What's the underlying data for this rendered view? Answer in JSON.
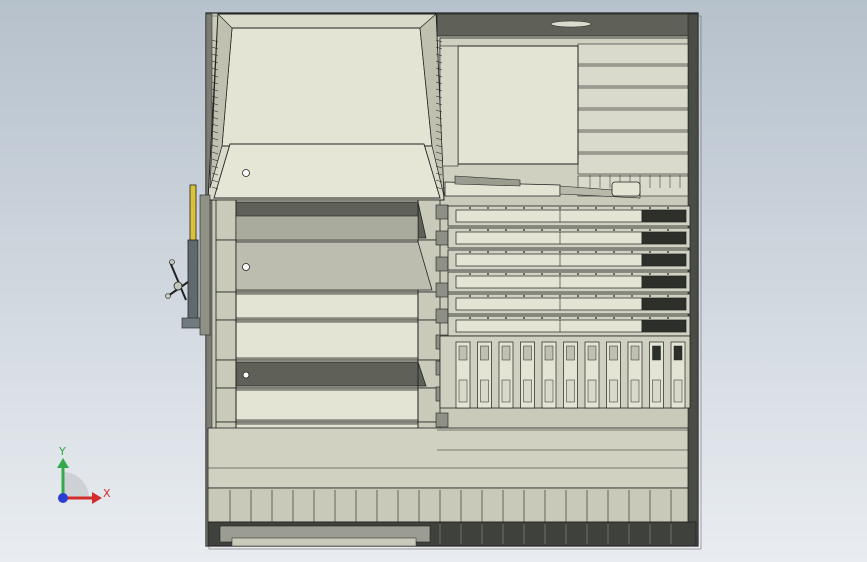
{
  "viewport": {
    "background_top": "#b6c1cc",
    "background_bottom": "#e9edf1"
  },
  "colors": {
    "outline": "#222222",
    "panel_light": "#e4e4d4",
    "panel_mid": "#c9cab9",
    "panel_dark": "#5f6158",
    "frame_dark": "#3f413c",
    "screen_dark": "#2d2f2b",
    "handle_yellow": "#d9c23a"
  },
  "triad": {
    "x_label": "X",
    "y_label": "Y",
    "x_color": "#d22c2c",
    "y_color": "#34a84a",
    "z_color": "#2a3fd0"
  },
  "model": {
    "tray_count": 6,
    "dark_flap_rows": 2,
    "light_step_rows": 5,
    "vertical_slot_count": 11,
    "handle_icon": "lever-handle-icon"
  }
}
